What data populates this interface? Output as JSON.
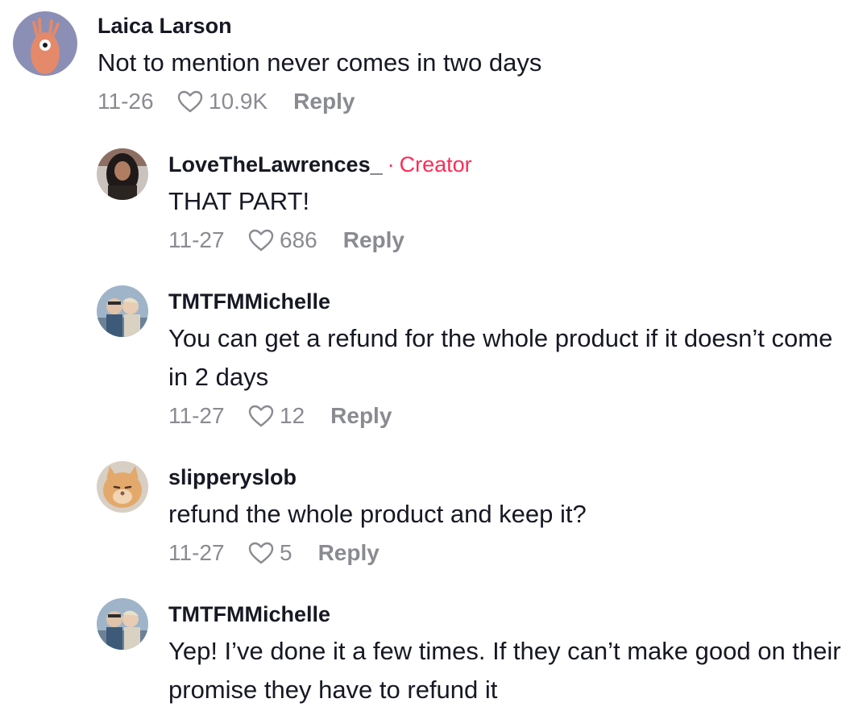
{
  "comments": [
    {
      "username": "Laica Larson",
      "text": "Not to mention never comes in two days",
      "date": "11-26",
      "likes": "10.9K",
      "reply_label": "Reply",
      "creator_label": "",
      "avatar_icon": "cartoon-creature-avatar"
    },
    {
      "username": "LoveTheLawrences_",
      "creator_sep": "·",
      "creator_label": "Creator",
      "text": "THAT PART!",
      "date": "11-27",
      "likes": "686",
      "reply_label": "Reply",
      "avatar_icon": "woman-portrait-avatar"
    },
    {
      "username": "TMTFMMichelle",
      "text": "You can get a refund for the whole product if it doesn’t come in 2 days",
      "date": "11-27",
      "likes": "12",
      "reply_label": "Reply",
      "avatar_icon": "couple-photo-avatar"
    },
    {
      "username": "slipperyslob",
      "text": "refund the whole product and keep it?",
      "date": "11-27",
      "likes": "5",
      "reply_label": "Reply",
      "avatar_icon": "cat-photo-avatar"
    },
    {
      "username": "TMTFMMichelle",
      "text": "Yep! I’ve done it a few times. If they can’t make good on their promise they have to refund it",
      "avatar_icon": "couple-photo-avatar"
    }
  ],
  "colors": {
    "creator": "#fe2c55",
    "meta": "#8a8b91",
    "text": "#161823"
  }
}
